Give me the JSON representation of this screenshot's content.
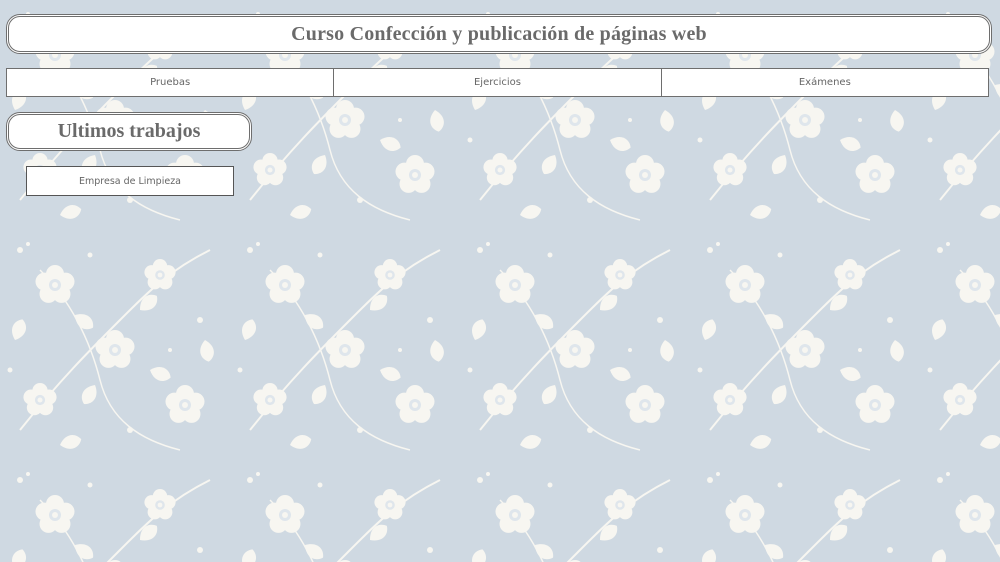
{
  "header": {
    "title": "Curso Confección y publicación de páginas web"
  },
  "nav": {
    "items": [
      {
        "label": "Pruebas"
      },
      {
        "label": "Ejercicios"
      },
      {
        "label": "Exámenes"
      }
    ]
  },
  "latest_works": {
    "title": "Ultimos trabajos",
    "items": [
      {
        "label": "Empresa de Limpieza"
      }
    ]
  },
  "colors": {
    "background": "#cfd9e2",
    "flower": "#f7f6f1",
    "border": "#6e6e6e",
    "text": "#666666"
  }
}
